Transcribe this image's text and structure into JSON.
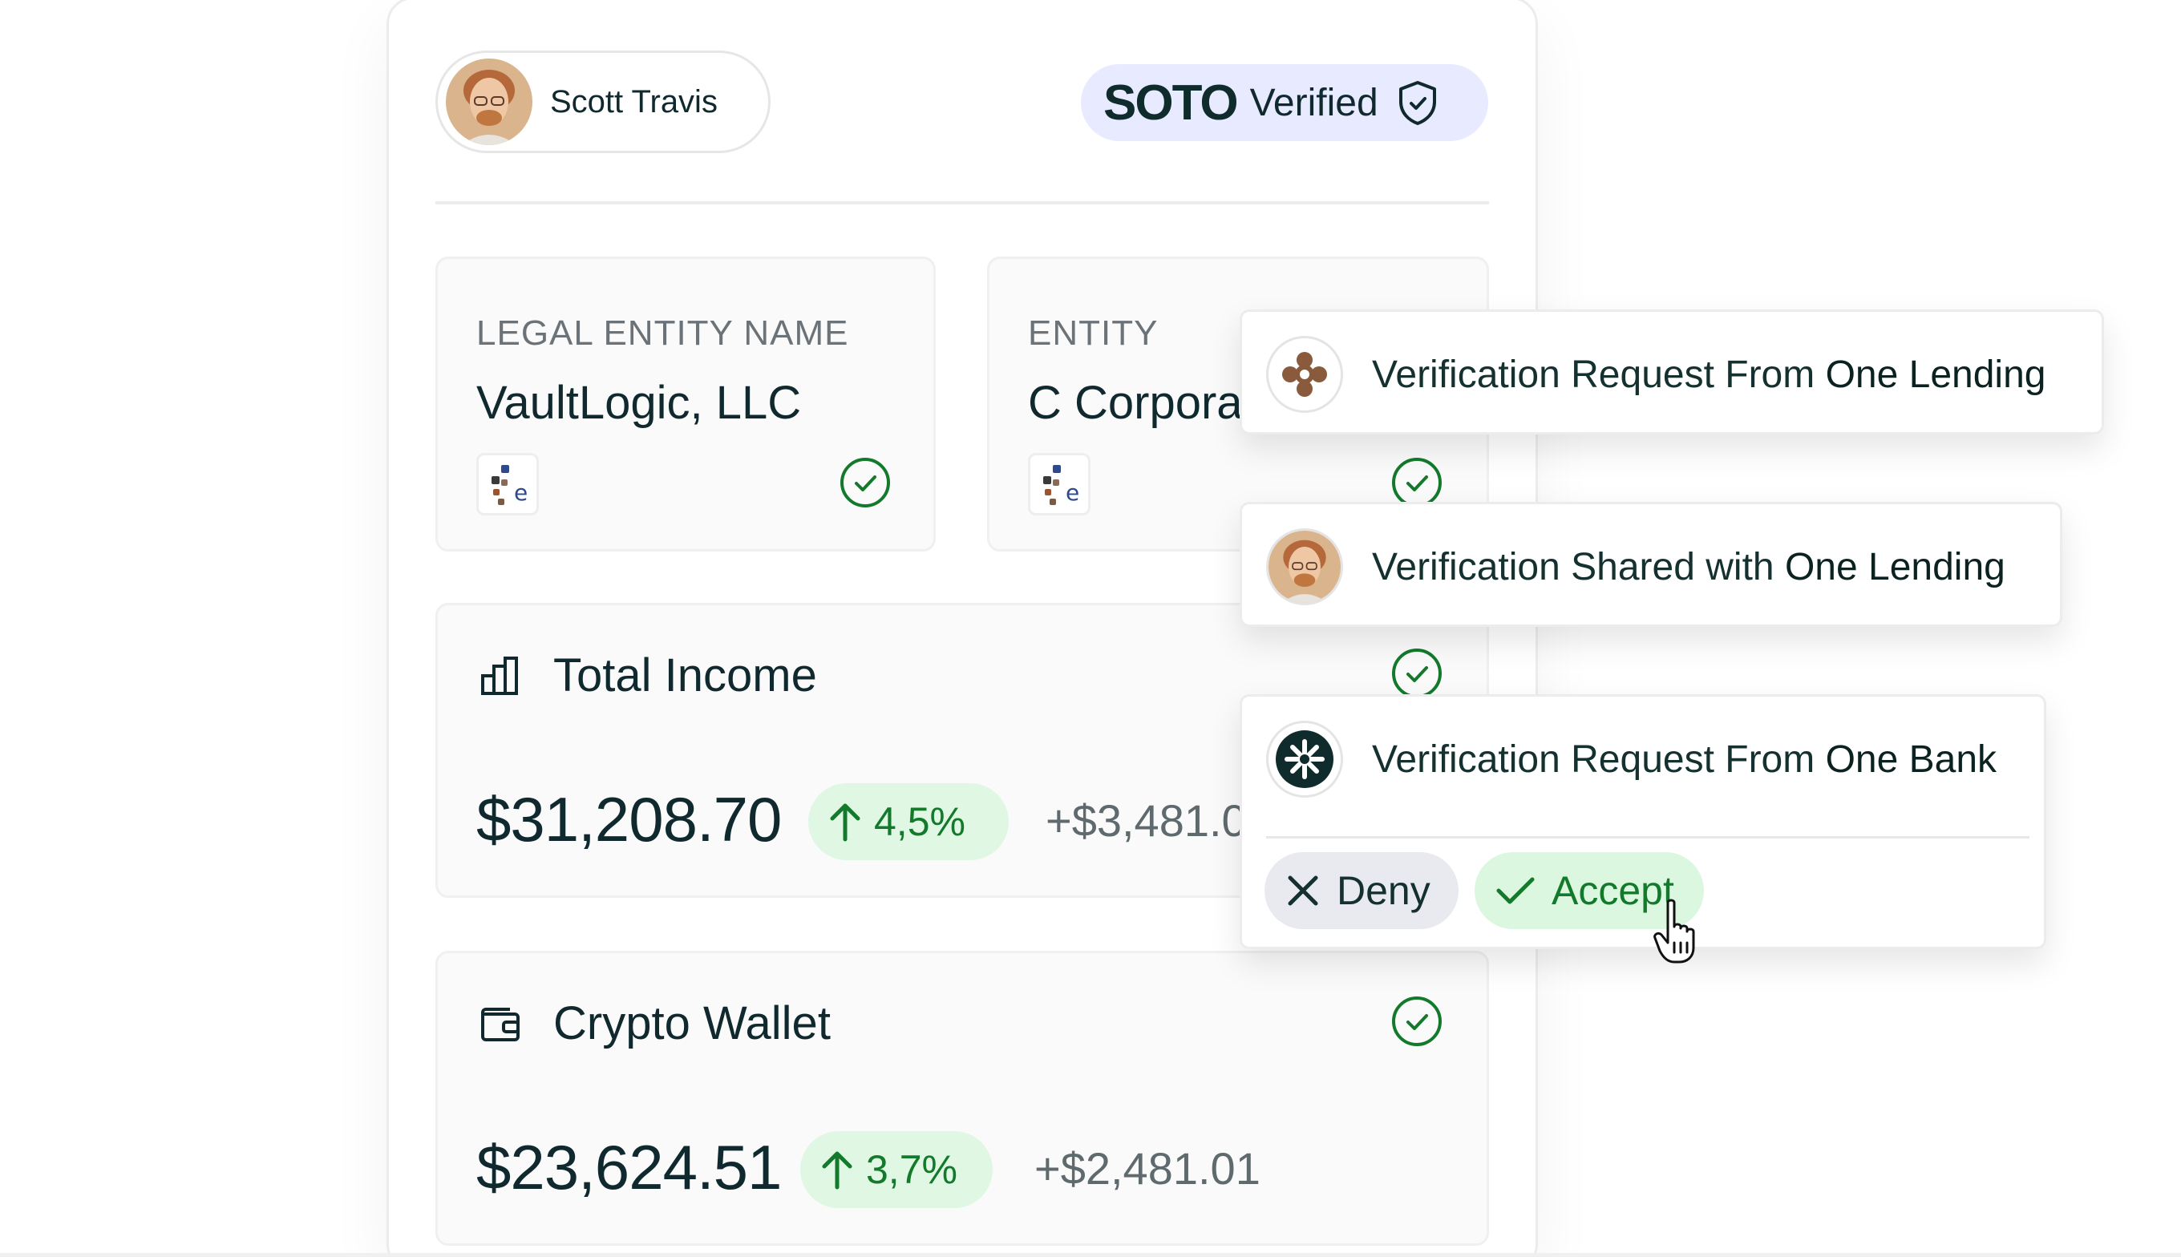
{
  "user": {
    "name": "Scott Travis"
  },
  "soto": {
    "logo": "SOTO",
    "verified": "Verified",
    "badge_color": "#e8ebff"
  },
  "entity_cards": [
    {
      "label": "LEGAL ENTITY NAME",
      "value": "VaultLogic, LLC"
    },
    {
      "label": "ENTITY",
      "value": "C Corporation"
    }
  ],
  "stats": [
    {
      "title": "Total Income",
      "amount": "$31,208.70",
      "percent": "4,5%",
      "delta": "+$3,481.01"
    },
    {
      "title": "Crypto Wallet",
      "amount": "$23,624.51",
      "percent": "3,7%",
      "delta": "+$2,481.01"
    }
  ],
  "notifications": [
    {
      "prefix": "Verification Request From ",
      "org": "One Lending",
      "icon": "one-lending-logo"
    },
    {
      "prefix": "Verification Shared with ",
      "org": "One Lending",
      "icon": "user-avatar"
    },
    {
      "prefix": "Verification Request From ",
      "org": "One Bank",
      "icon": "one-bank-logo"
    }
  ],
  "actions": {
    "deny": "Deny",
    "accept": "Accept"
  },
  "colors": {
    "accent_green": "#137a2c",
    "positive_bg": "#dff7e3",
    "text_dark": "#10292e"
  }
}
